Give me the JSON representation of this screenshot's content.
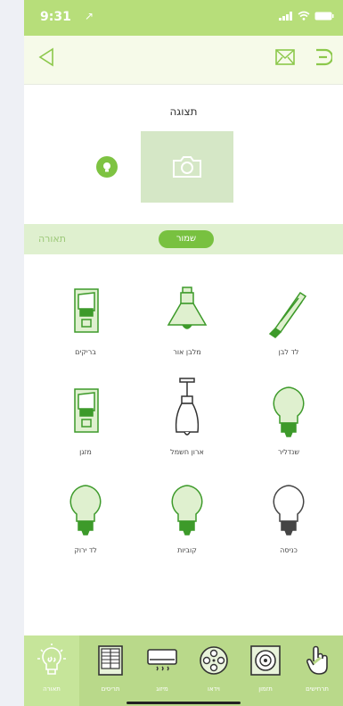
{
  "status": {
    "time": "9:31",
    "location_glyph": "↗"
  },
  "screen": {
    "preview_title": "תצוגה"
  },
  "category": {
    "label": "תאורה",
    "save_label": "שמור"
  },
  "items": [
    {
      "label": "לד לבן",
      "icon": "fluorescent-lamp-icon"
    },
    {
      "label": "מלבן אור",
      "icon": "ceiling-lamp-icon"
    },
    {
      "label": "בריקים",
      "icon": "wall-switch-icon"
    },
    {
      "label": "שנדליר",
      "icon": "bulb-icon"
    },
    {
      "label": "ארון חשמל",
      "icon": "pendant-lamp-icon"
    },
    {
      "label": "מזגן",
      "icon": "wall-switch-icon"
    },
    {
      "label": "כניסה",
      "icon": "bulb-off-icon"
    },
    {
      "label": "קוביות",
      "icon": "bulb-icon"
    },
    {
      "label": "לד ירוק",
      "icon": "bulb-icon"
    }
  ],
  "tabs": [
    {
      "label": "תרחישים",
      "icon": "hand-pointer-icon"
    },
    {
      "label": "תזמון",
      "icon": "timer-dial-icon"
    },
    {
      "label": "וידאו",
      "icon": "film-reel-icon"
    },
    {
      "label": "מיזוג",
      "icon": "air-conditioner-icon"
    },
    {
      "label": "תריסים",
      "icon": "window-blinds-icon"
    },
    {
      "label": "תאורה",
      "icon": "lightbulb-icon"
    }
  ],
  "colors": {
    "accent": "#78c140",
    "header": "#b7de7a",
    "tabbar": "#b9d98a",
    "catbar": "#dff0cf"
  }
}
